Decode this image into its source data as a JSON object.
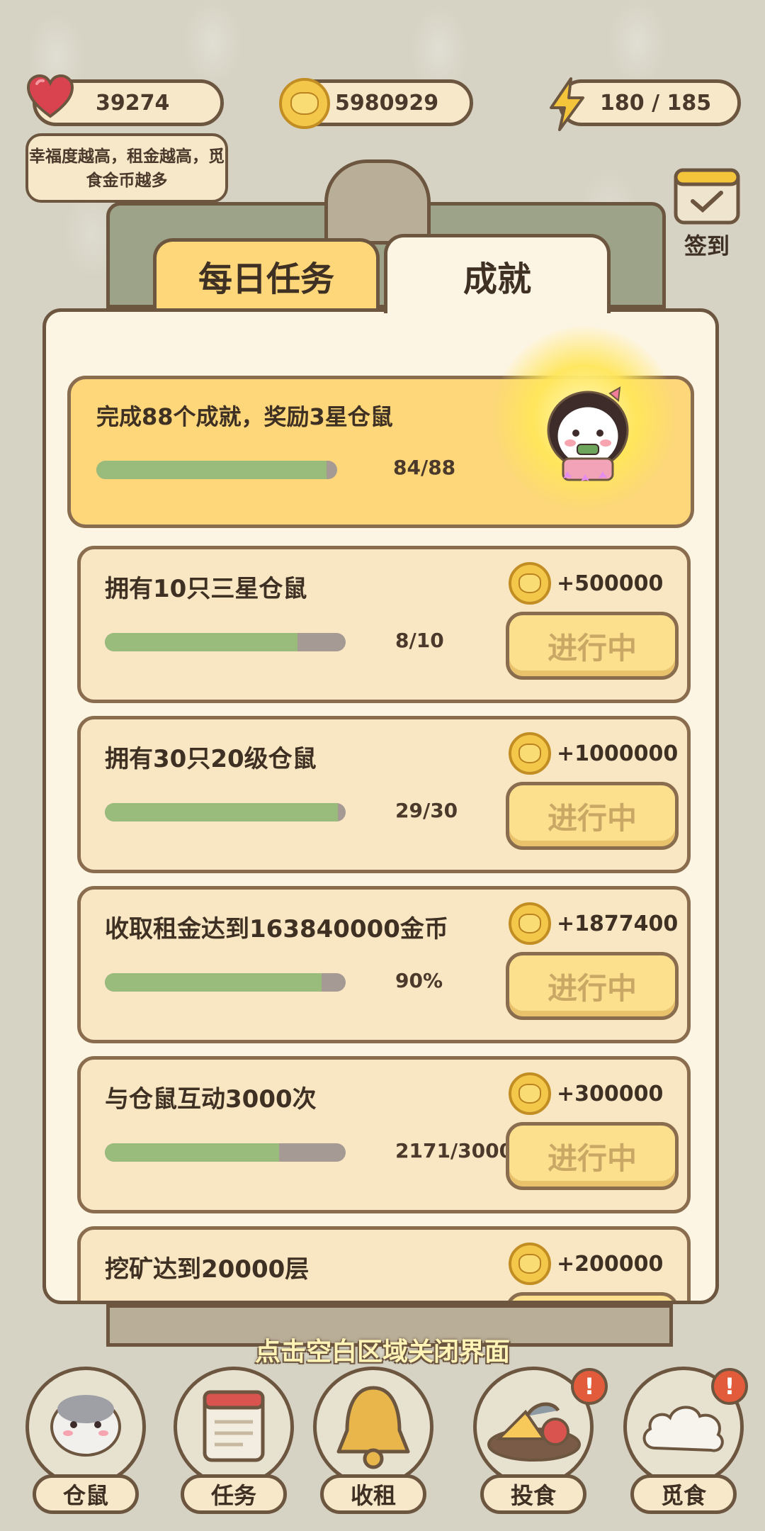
{
  "stats": {
    "happiness": "39274",
    "coins": "5980929",
    "energy": "180 / 185",
    "tip": "幸福度越高，租金越高，觅食金币越多"
  },
  "signin": {
    "label": "签到"
  },
  "tabs": [
    {
      "label": "每日任务"
    },
    {
      "label": "成就"
    }
  ],
  "banner": {
    "title": "完成88个成就，奖励3星仓鼠",
    "progress_text": "84/88",
    "progress": 0.955
  },
  "achievements": [
    {
      "title": "拥有10只三星仓鼠",
      "reward": "+500000",
      "progress_text": "8/10",
      "progress": 0.8,
      "button": "进行中"
    },
    {
      "title": "拥有30只20级仓鼠",
      "reward": "+1000000",
      "progress_text": "29/30",
      "progress": 0.967,
      "button": "进行中"
    },
    {
      "title": "收取租金达到163840000金币",
      "reward": "+1877400",
      "progress_text": "90%",
      "progress": 0.9,
      "button": "进行中"
    },
    {
      "title": "与仓鼠互动3000次",
      "reward": "+300000",
      "progress_text": "2171/3000",
      "progress": 0.724,
      "button": "进行中"
    },
    {
      "title": "挖矿达到20000层",
      "reward": "+200000",
      "progress_text": "",
      "progress": 0,
      "button": ""
    }
  ],
  "hint": "点击空白区域关闭界面",
  "nav": [
    {
      "label": "仓鼠",
      "badge": ""
    },
    {
      "label": "任务",
      "badge": ""
    },
    {
      "label": "收租",
      "badge": ""
    },
    {
      "label": "投食",
      "badge": "!"
    },
    {
      "label": "觅食",
      "badge": "!"
    }
  ]
}
